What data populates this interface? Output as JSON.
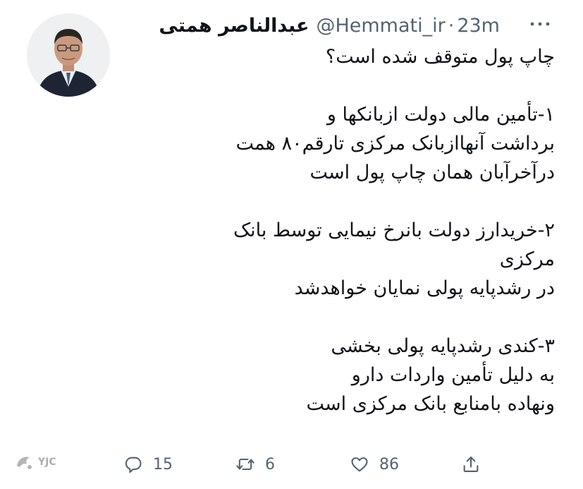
{
  "tweet": {
    "author": {
      "display_name": "عبدالناصر همتی",
      "handle": "@Hemmati_ir",
      "time": "23m"
    },
    "separator": "·",
    "more_icon": "more-horizontal-icon",
    "lines": [
      "چاپ پول متوقف شده است؟",
      "",
      "۱-تأمین مالی دولت ازبانکها و",
      "برداشت آنهاازبانک مرکزی تارقم۸۰ همت",
      "درآخرآبان همان چاپ پول است",
      "",
      "۲-خریدارز دولت بانرخ نیمایی توسط بانک",
      "مرکزی",
      "در رشدپایه پولی نمایان خواهدشد",
      "",
      "۳-کندی رشدپایه پولی بخشی",
      "به دلیل تأمین واردات دارو",
      "ونهاده بامنابع بانک مرکزی است"
    ],
    "actions": {
      "reply": {
        "icon": "reply-icon",
        "count": "15"
      },
      "retweet": {
        "icon": "retweet-icon",
        "count": "6"
      },
      "like": {
        "icon": "heart-icon",
        "count": "86"
      },
      "share": {
        "icon": "share-icon"
      }
    }
  },
  "watermark": {
    "text": "YJC"
  },
  "colors": {
    "text_primary": "#0f1419",
    "text_secondary": "#536471",
    "icon": "#536471"
  }
}
